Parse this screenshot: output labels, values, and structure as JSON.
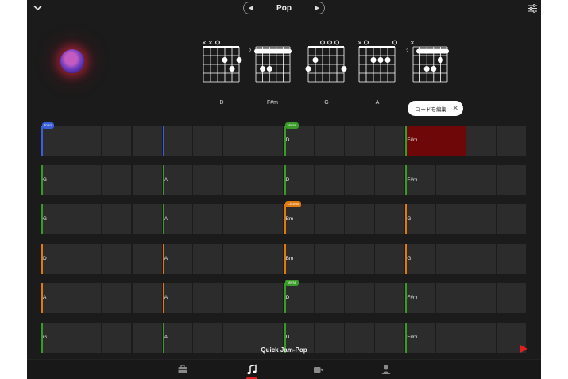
{
  "header": {
    "collapse_icon": "chevron-down-icon",
    "genre": "Pop",
    "settings_icon": "sliders-icon"
  },
  "chords": [
    {
      "name": "D"
    },
    {
      "name": "F#m",
      "fret": "2"
    },
    {
      "name": "G"
    },
    {
      "name": "A"
    },
    {
      "name": "",
      "fret": "2"
    }
  ],
  "edit_pill": {
    "label": "コードを編集",
    "close_icon": "close-icon"
  },
  "grid": {
    "rows": [
      {
        "bars": [
          {
            "chord": "",
            "tag": "Intro",
            "tag_color": "#3a5fd8",
            "line_color": "#3a5fd8"
          },
          {
            "chord": "",
            "line_color": "#3a5fd8"
          },
          {
            "chord": "D",
            "tag": "Verse",
            "tag_color": "#3a9a2a",
            "line_color": "#3a9a2a"
          },
          {
            "chord": "F#m",
            "line_color": "#3a9a2a",
            "highlight": true
          }
        ]
      },
      {
        "bars": [
          {
            "chord": "G",
            "line_color": "#3a9a2a"
          },
          {
            "chord": "A",
            "line_color": "#3a9a2a"
          },
          {
            "chord": "D",
            "line_color": "#3a9a2a"
          },
          {
            "chord": "F#m",
            "line_color": "#3a9a2a"
          }
        ]
      },
      {
        "bars": [
          {
            "chord": "G",
            "line_color": "#3a9a2a"
          },
          {
            "chord": "A",
            "line_color": "#3a9a2a"
          },
          {
            "chord": "Bm",
            "tag": "Chorus",
            "tag_color": "#e07a10",
            "line_color": "#e07a10"
          },
          {
            "chord": "G",
            "line_color": "#e07a10"
          }
        ]
      },
      {
        "bars": [
          {
            "chord": "D",
            "line_color": "#e07a10"
          },
          {
            "chord": "A",
            "line_color": "#e07a10"
          },
          {
            "chord": "Bm",
            "line_color": "#e07a10"
          },
          {
            "chord": "G",
            "line_color": "#e07a10"
          }
        ]
      },
      {
        "bars": [
          {
            "chord": "A",
            "line_color": "#e07a10"
          },
          {
            "chord": "A",
            "line_color": "#e07a10"
          },
          {
            "chord": "D",
            "tag": "Verse",
            "tag_color": "#3a9a2a",
            "line_color": "#3a9a2a"
          },
          {
            "chord": "F#m",
            "line_color": "#3a9a2a"
          }
        ]
      },
      {
        "bars": [
          {
            "chord": "G",
            "line_color": "#3a9a2a"
          },
          {
            "chord": "A",
            "line_color": "#3a9a2a"
          },
          {
            "chord": "D",
            "line_color": "#3a9a2a"
          },
          {
            "chord": "F#m",
            "line_color": "#3a9a2a"
          }
        ]
      }
    ]
  },
  "footer": {
    "song_title": "Quick Jam-Pop",
    "play_icon": "play-icon"
  },
  "tabs": [
    {
      "icon": "briefcase-icon"
    },
    {
      "icon": "music-note-icon",
      "active": true
    },
    {
      "icon": "video-camera-icon"
    },
    {
      "icon": "person-icon"
    }
  ],
  "colors": {
    "accent": "#e02020",
    "bg": "#1b1b1b",
    "cell": "#2c2c2c"
  }
}
